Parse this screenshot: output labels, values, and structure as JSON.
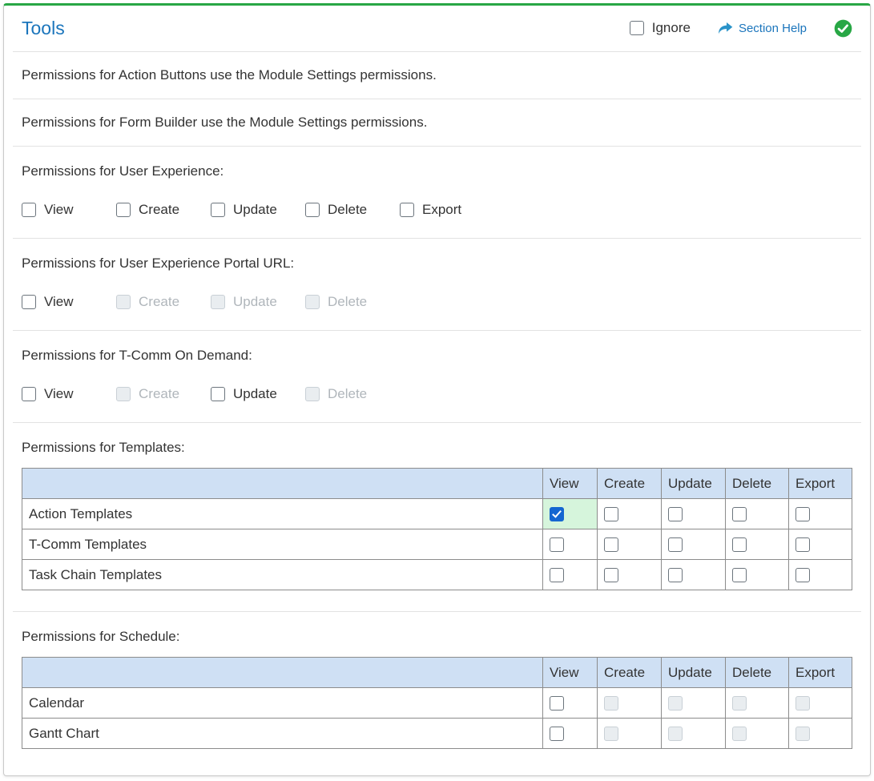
{
  "header": {
    "title": "Tools",
    "ignore_label": "Ignore",
    "section_help_label": "Section Help"
  },
  "colors": {
    "accent_green": "#28a745",
    "title_blue": "#1b75bc",
    "table_header_bg": "#cfe0f4",
    "checked_cell_bg": "#d6f5dc",
    "checkbox_checked_blue": "#1566d1"
  },
  "notes": [
    {
      "text": "Permissions for Action Buttons use the Module Settings permissions."
    },
    {
      "text": "Permissions for Form Builder use the Module Settings permissions."
    }
  ],
  "sections": [
    {
      "heading": "Permissions for User Experience:",
      "options": [
        {
          "label": "View",
          "checked": false,
          "disabled": false
        },
        {
          "label": "Create",
          "checked": false,
          "disabled": false
        },
        {
          "label": "Update",
          "checked": false,
          "disabled": false
        },
        {
          "label": "Delete",
          "checked": false,
          "disabled": false
        },
        {
          "label": "Export",
          "checked": false,
          "disabled": false
        }
      ]
    },
    {
      "heading": "Permissions for User Experience Portal URL:",
      "options": [
        {
          "label": "View",
          "checked": false,
          "disabled": false
        },
        {
          "label": "Create",
          "checked": false,
          "disabled": true
        },
        {
          "label": "Update",
          "checked": false,
          "disabled": true
        },
        {
          "label": "Delete",
          "checked": false,
          "disabled": true
        }
      ]
    },
    {
      "heading": "Permissions for T-Comm On Demand:",
      "options": [
        {
          "label": "View",
          "checked": false,
          "disabled": false
        },
        {
          "label": "Create",
          "checked": false,
          "disabled": true
        },
        {
          "label": "Update",
          "checked": false,
          "disabled": false
        },
        {
          "label": "Delete",
          "checked": false,
          "disabled": true
        }
      ]
    }
  ],
  "tables": [
    {
      "heading": "Permissions for Templates:",
      "columns": [
        "View",
        "Create",
        "Update",
        "Delete",
        "Export"
      ],
      "rows": [
        {
          "label": "Action Templates",
          "cells": [
            {
              "checked": true,
              "disabled": false,
              "highlight": true
            },
            {
              "checked": false,
              "disabled": false
            },
            {
              "checked": false,
              "disabled": false
            },
            {
              "checked": false,
              "disabled": false
            },
            {
              "checked": false,
              "disabled": false
            }
          ]
        },
        {
          "label": "T-Comm Templates",
          "cells": [
            {
              "checked": false,
              "disabled": false
            },
            {
              "checked": false,
              "disabled": false
            },
            {
              "checked": false,
              "disabled": false
            },
            {
              "checked": false,
              "disabled": false
            },
            {
              "checked": false,
              "disabled": false
            }
          ]
        },
        {
          "label": "Task Chain Templates",
          "cells": [
            {
              "checked": false,
              "disabled": false
            },
            {
              "checked": false,
              "disabled": false
            },
            {
              "checked": false,
              "disabled": false
            },
            {
              "checked": false,
              "disabled": false
            },
            {
              "checked": false,
              "disabled": false
            }
          ]
        }
      ]
    },
    {
      "heading": "Permissions for Schedule:",
      "columns": [
        "View",
        "Create",
        "Update",
        "Delete",
        "Export"
      ],
      "rows": [
        {
          "label": "Calendar",
          "cells": [
            {
              "checked": false,
              "disabled": false
            },
            {
              "checked": false,
              "disabled": true
            },
            {
              "checked": false,
              "disabled": true
            },
            {
              "checked": false,
              "disabled": true
            },
            {
              "checked": false,
              "disabled": true
            }
          ]
        },
        {
          "label": "Gantt Chart",
          "cells": [
            {
              "checked": false,
              "disabled": false
            },
            {
              "checked": false,
              "disabled": true
            },
            {
              "checked": false,
              "disabled": true
            },
            {
              "checked": false,
              "disabled": true
            },
            {
              "checked": false,
              "disabled": true
            }
          ]
        }
      ]
    }
  ]
}
